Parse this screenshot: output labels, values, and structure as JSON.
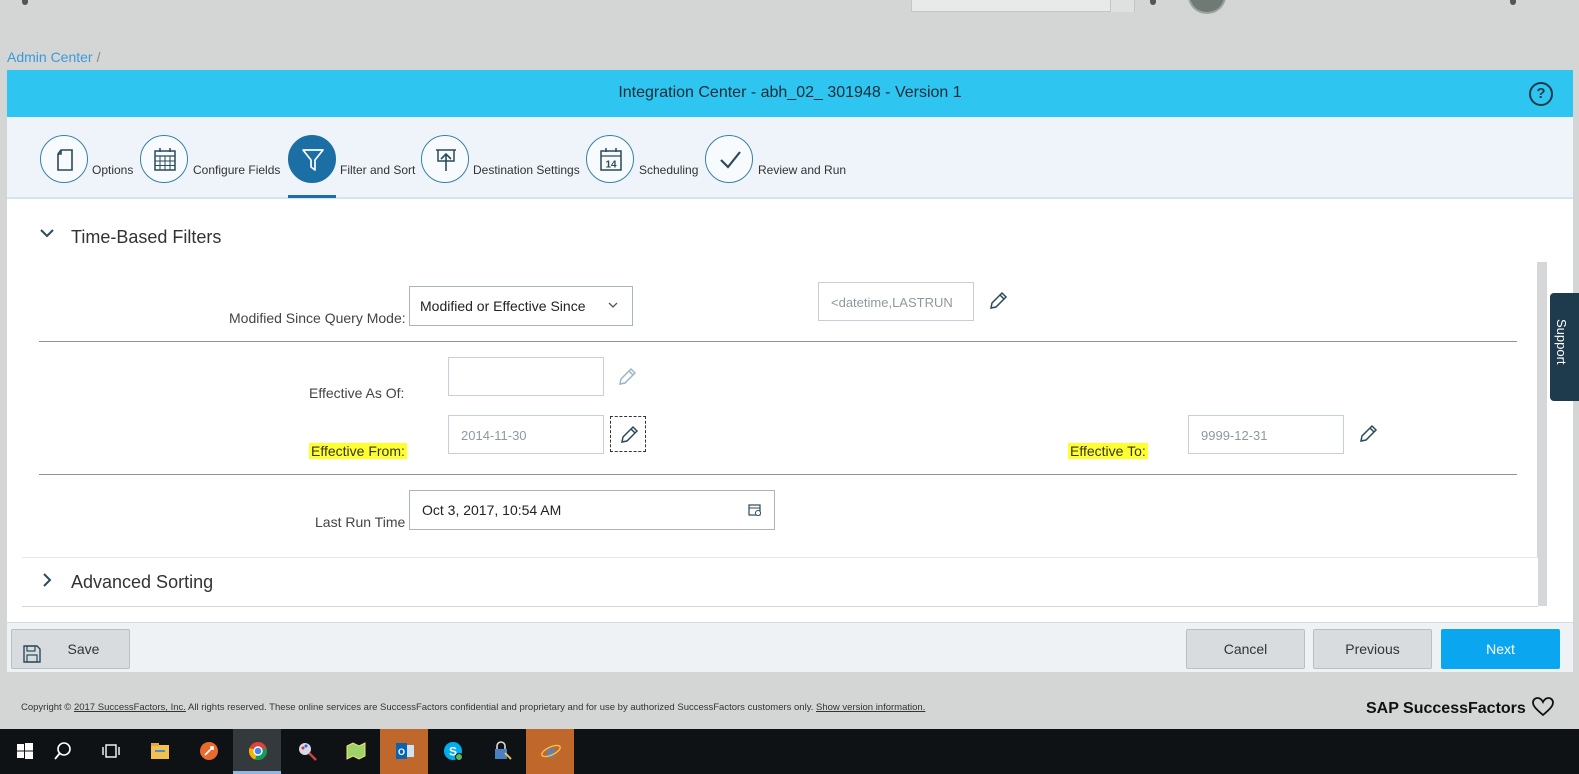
{
  "breadcrumb": {
    "root": "Admin Center",
    "separator": "/"
  },
  "header": {
    "title": "Integration Center - abh_02_ 301948 - Version 1",
    "help_label": "?"
  },
  "steps": [
    {
      "label": "Options",
      "icon": "document-icon"
    },
    {
      "label": "Configure Fields",
      "icon": "calendar-grid-icon"
    },
    {
      "label": "Filter and Sort",
      "icon": "filter-icon",
      "active": true
    },
    {
      "label": "Destination Settings",
      "icon": "upload-screen-icon"
    },
    {
      "label": "Scheduling",
      "icon": "calendar-14-icon",
      "calendar_day": "14"
    },
    {
      "label": "Review and Run",
      "icon": "checkmark-icon"
    }
  ],
  "time_filters": {
    "title": "Time-Based Filters",
    "modified_since_label": "Modified Since Query Mode:",
    "modified_since_value": "Modified or Effective Since",
    "lastrun_value": "<datetime,LASTRUN",
    "effective_as_of_label": "Effective As Of:",
    "effective_as_of_value": "",
    "effective_from_label": "Effective From:",
    "effective_from_value": "2014-11-30",
    "effective_to_label": "Effective To:",
    "effective_to_value": "9999-12-31",
    "last_run_label": "Last Run Time",
    "last_run_value": "Oct 3, 2017, 10:54 AM"
  },
  "advanced_sorting": {
    "title": "Advanced Sorting"
  },
  "footer_buttons": {
    "save": "Save",
    "cancel": "Cancel",
    "previous": "Previous",
    "next": "Next"
  },
  "support_tab": "Support",
  "copyright": {
    "prefix": "Copyright ©",
    "link": "2017 SuccessFactors, Inc.",
    "body": "All rights reserved. These online services are SuccessFactors confidential and proprietary and for use by authorized SuccessFactors customers only.",
    "version_link": "Show version information."
  },
  "brand": "SAP SuccessFactors",
  "colors": {
    "header": "#2ec5f0",
    "active_step": "#1c6fa4",
    "primary_button": "#0aa6f0",
    "highlight": "#ffff2e"
  },
  "taskbar": [
    "windows-start-icon",
    "search-icon",
    "task-view-icon",
    "file-explorer-icon",
    "rocket-app-icon",
    "chrome-icon",
    "paint-app-icon",
    "maps-app-icon",
    "outlook-icon",
    "skype-icon",
    "keepass-icon",
    "internet-explorer-icon"
  ]
}
